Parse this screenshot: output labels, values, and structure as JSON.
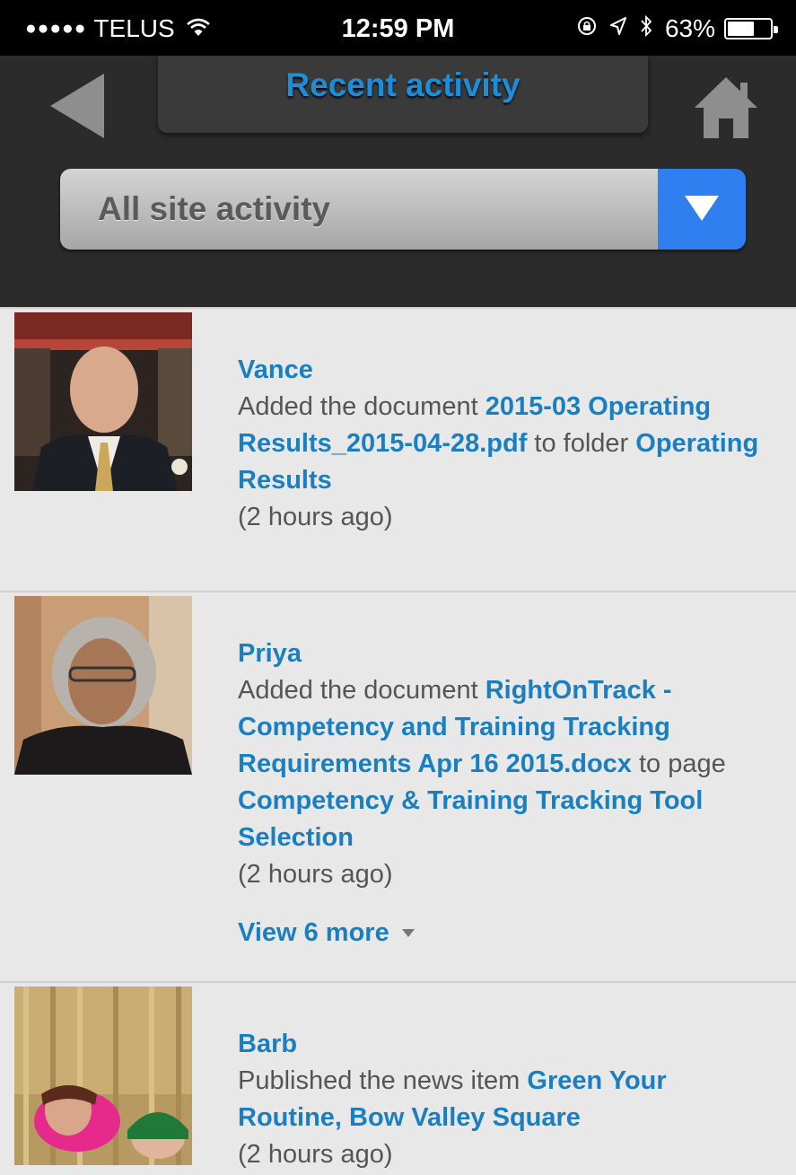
{
  "status_bar": {
    "signal_dots": "●●●●●",
    "carrier": "TELUS",
    "wifi_icon": "wifi-icon",
    "time": "12:59 PM",
    "orientation_lock_icon": "orientation-lock-icon",
    "location_icon": "location-icon",
    "bluetooth_icon": "bluetooth-icon",
    "battery_text": "63%",
    "battery_level": 0.63
  },
  "header": {
    "title": "Recent activity",
    "back_icon": "back-arrow-icon",
    "home_icon": "home-icon",
    "title_color": "#1c8dd6"
  },
  "filter": {
    "selected": "All site activity",
    "dropdown_icon": "chevron-down-icon",
    "accent": "#2f7ff0"
  },
  "feed": {
    "items": [
      {
        "name": "Vance",
        "action": "Added the document ",
        "doc": "2015-03 Operating Results_2015-04-28.pdf",
        "joiner": " to folder ",
        "target": "Operating Results",
        "time": "(2 hours ago)"
      },
      {
        "name": "Priya",
        "action": "Added the document ",
        "doc": "RightOnTrack - Competency and Training Tracking Requirements Apr 16 2015.docx",
        "joiner": " to page ",
        "target": "Competency & Training Tracking Tool Selection",
        "time": "(2 hours ago)",
        "more": "View 6 more"
      },
      {
        "name": "Barb",
        "action": "Published the news item ",
        "doc": "Green Your Routine, Bow Valley Square",
        "time": "(2 hours ago)"
      }
    ]
  }
}
